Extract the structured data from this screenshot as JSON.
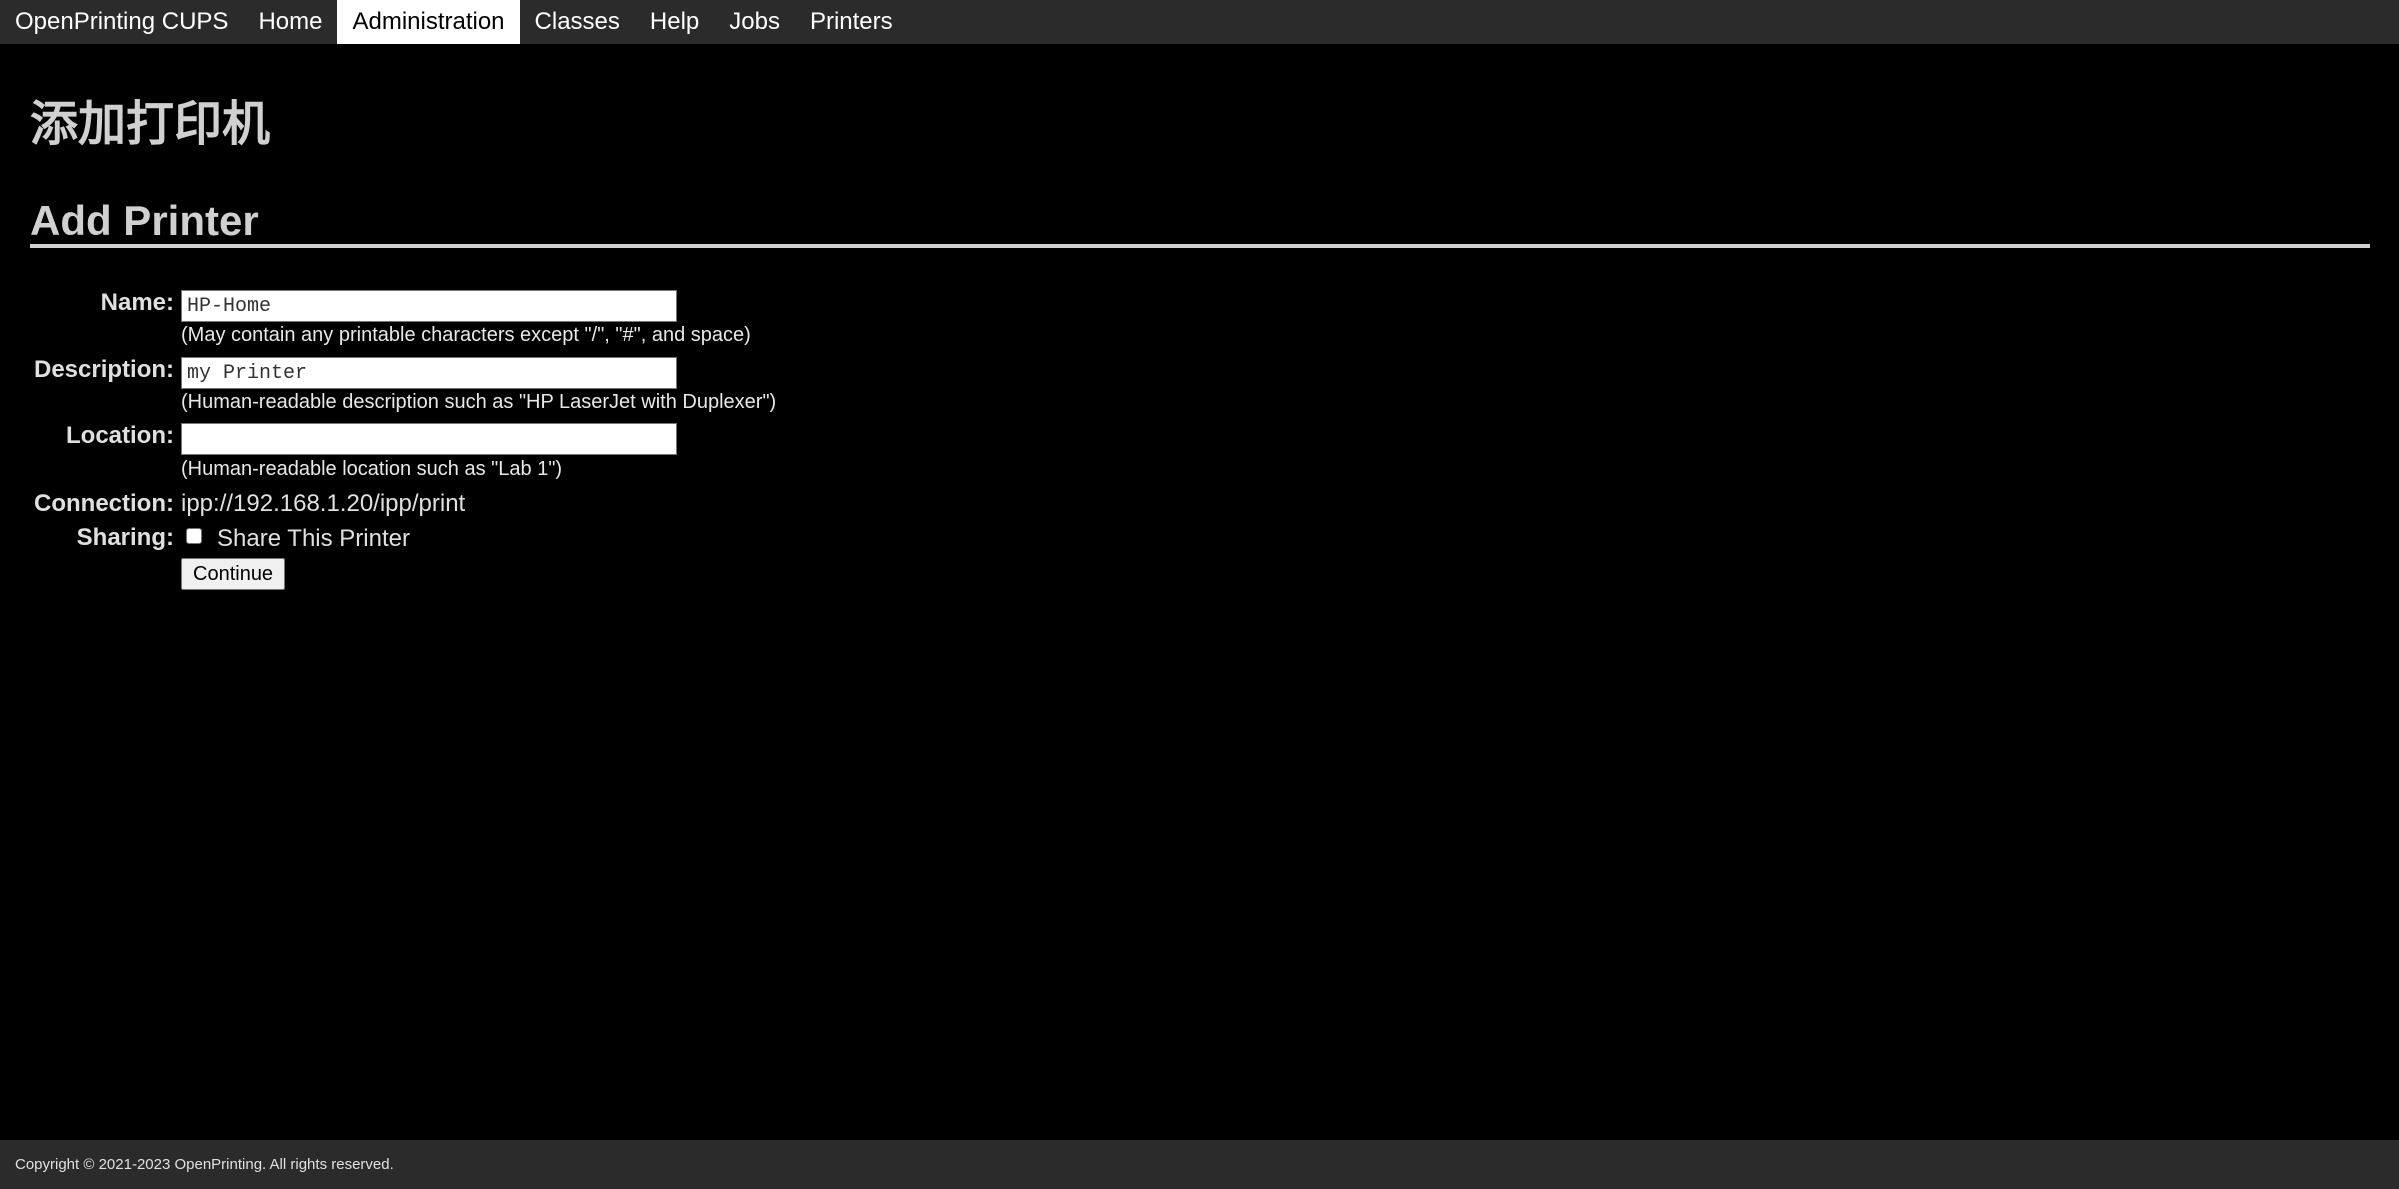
{
  "nav": {
    "brand": "OpenPrinting CUPS",
    "items": [
      {
        "label": "Home",
        "active": false
      },
      {
        "label": "Administration",
        "active": true
      },
      {
        "label": "Classes",
        "active": false
      },
      {
        "label": "Help",
        "active": false
      },
      {
        "label": "Jobs",
        "active": false
      },
      {
        "label": "Printers",
        "active": false
      }
    ]
  },
  "page": {
    "title_cn": "添加打印机",
    "title_en": "Add Printer"
  },
  "form": {
    "name": {
      "label": "Name:",
      "value": "HP-Home",
      "hint": "(May contain any printable characters except \"/\", \"#\", and space)"
    },
    "description": {
      "label": "Description:",
      "value": "my Printer",
      "hint": "(Human-readable description such as \"HP LaserJet with Duplexer\")"
    },
    "location": {
      "label": "Location:",
      "value": "",
      "hint": "(Human-readable location such as \"Lab 1\")"
    },
    "connection": {
      "label": "Connection:",
      "value": "ipp://192.168.1.20/ipp/print"
    },
    "sharing": {
      "label": "Sharing:",
      "checkbox_label": "Share This Printer",
      "checked": false
    },
    "continue_label": "Continue"
  },
  "footer": {
    "copyright": "Copyright © 2021-2023 OpenPrinting. All rights reserved."
  },
  "colors": {
    "background": "#000000",
    "navbar": "#2b2b2b",
    "active_tab": "#ffffff",
    "text": "#d8d8d8"
  }
}
